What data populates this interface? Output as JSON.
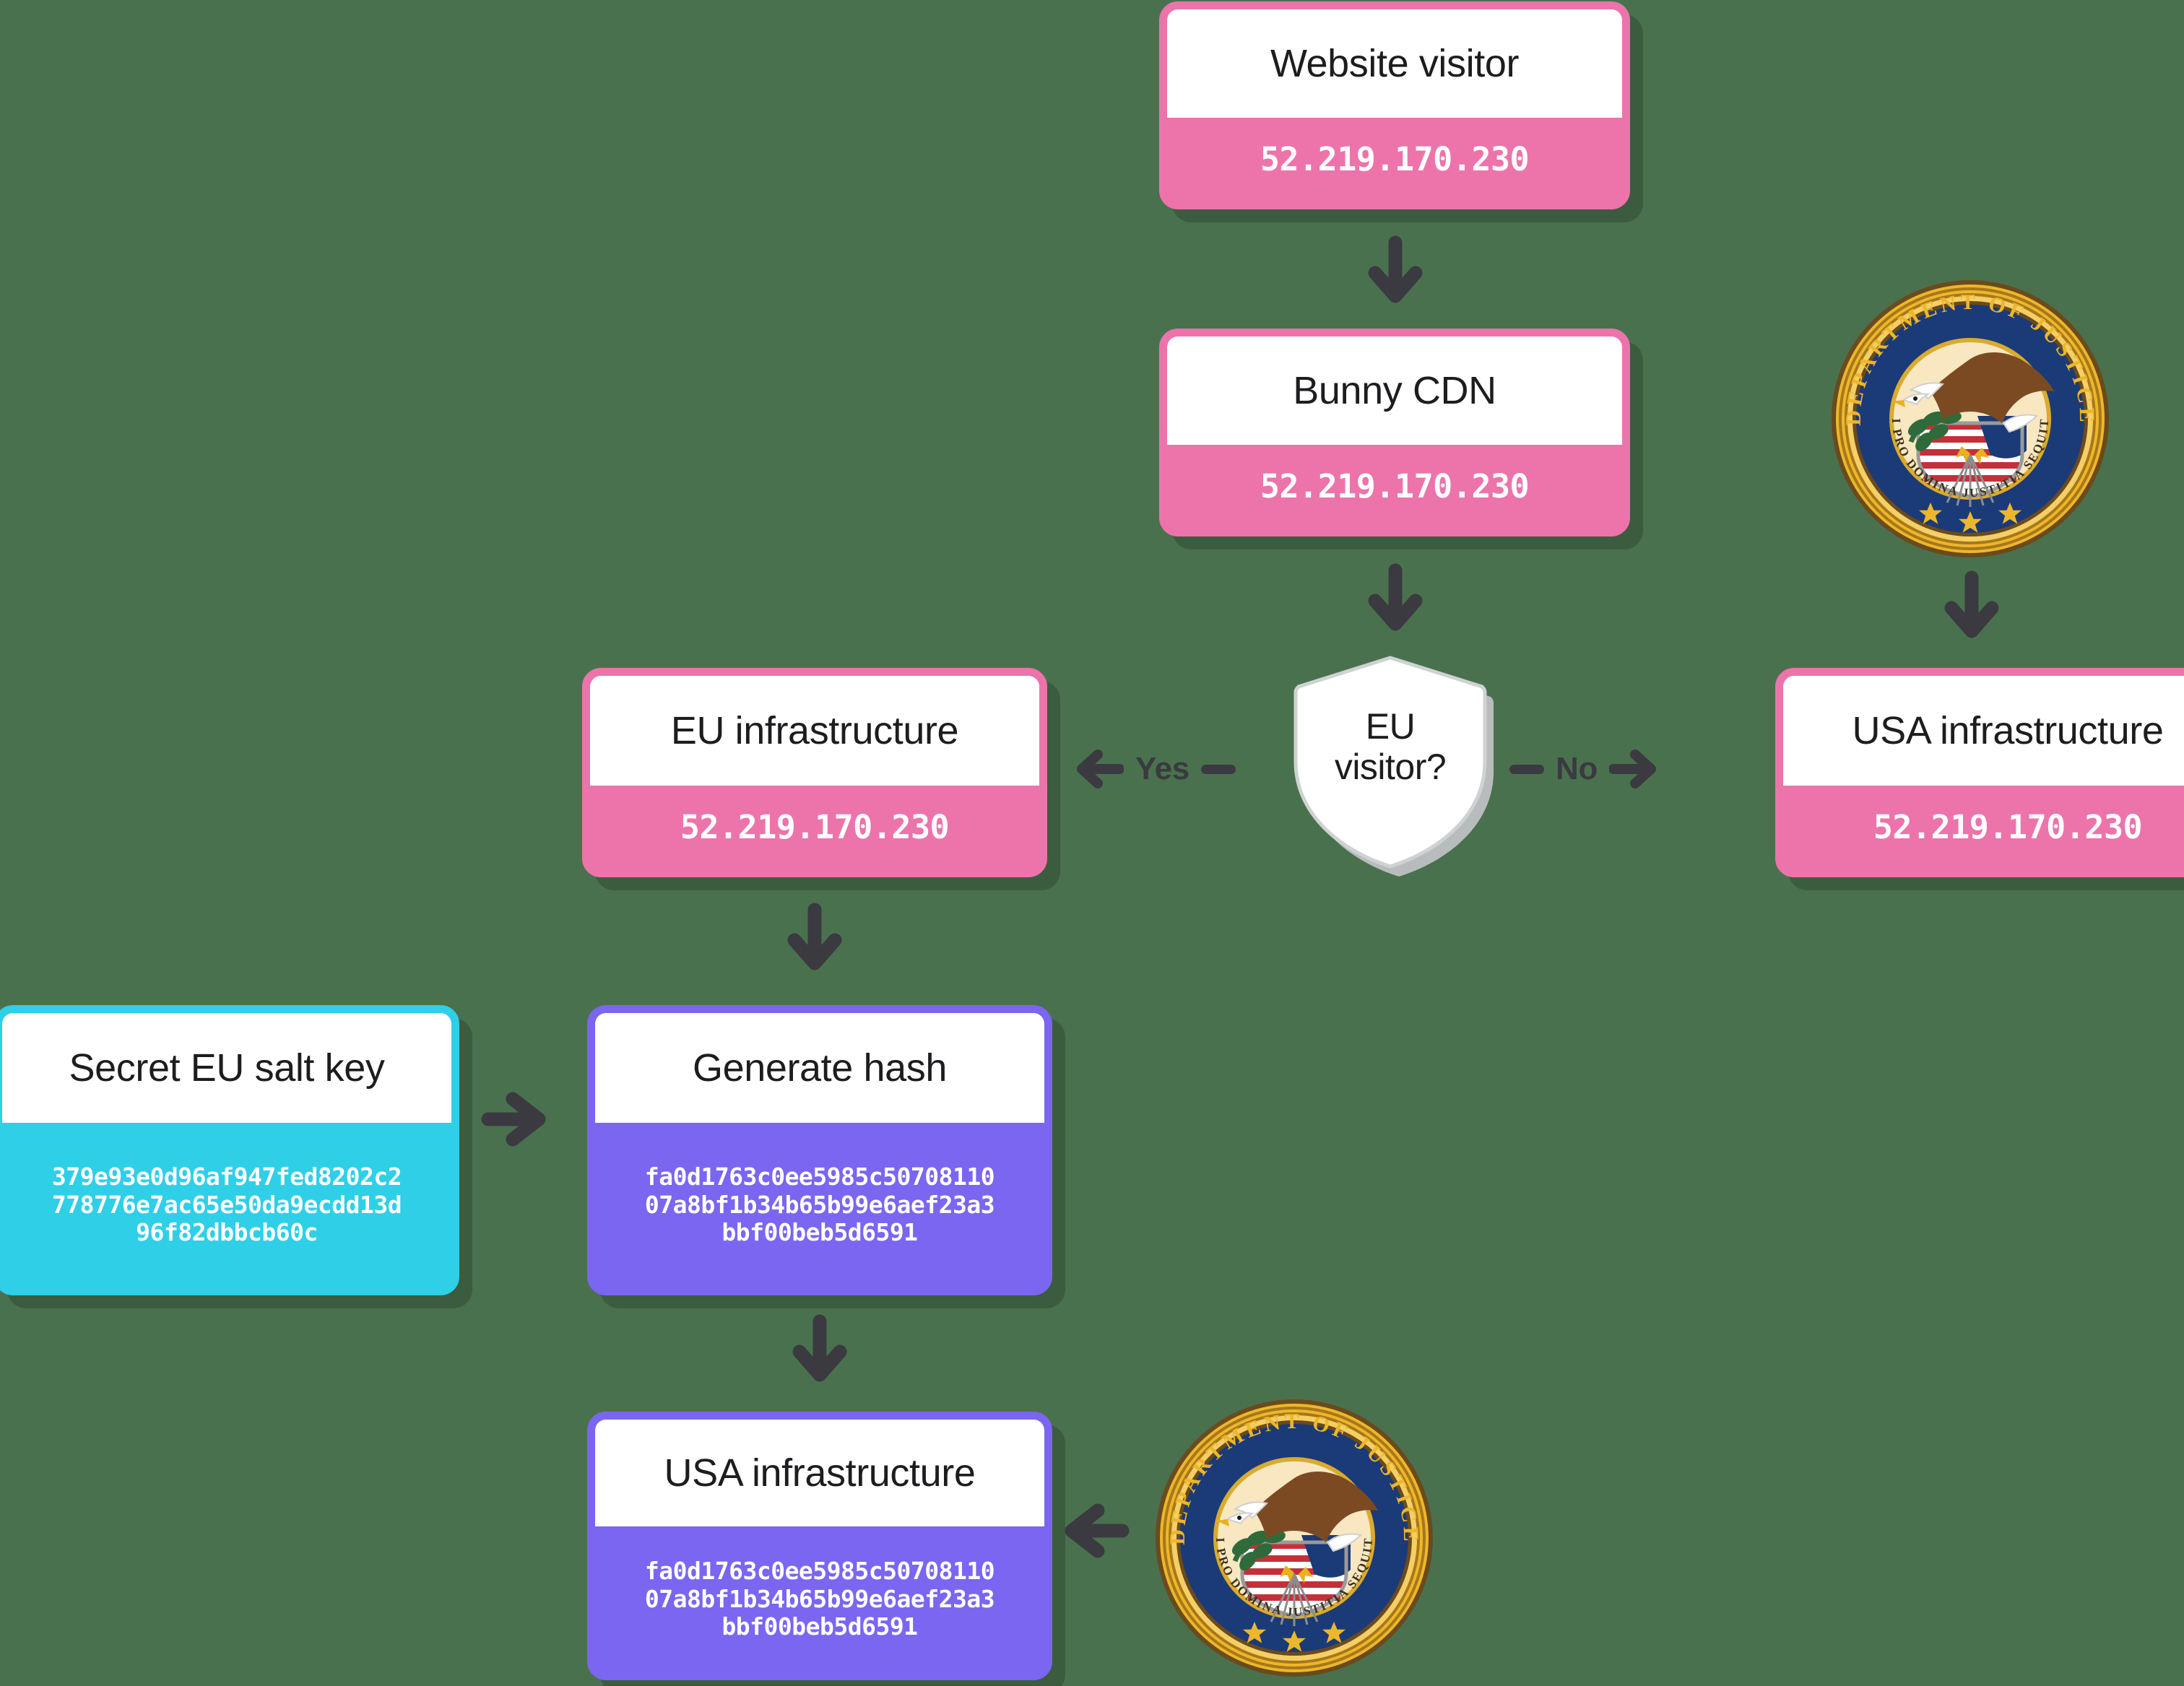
{
  "background_color": "#4a714e",
  "palette": {
    "pink": "#ec74ab",
    "purple": "#7a66f0",
    "cyan": "#2fcfe8",
    "arrow": "#3a3a40",
    "card_title_bg": "#ffffff",
    "shield_fill": "#ffffff",
    "shield_shadow": "#b9bcbd"
  },
  "diagram": {
    "type": "flowchart",
    "nodes": {
      "website_visitor": {
        "title": "Website visitor",
        "value": "52.219.170.230",
        "color": "pink"
      },
      "bunny_cdn": {
        "title": "Bunny CDN",
        "value": "52.219.170.230",
        "color": "pink"
      },
      "decision": {
        "line1": "EU",
        "line2": "visitor?",
        "shape": "shield"
      },
      "eu_infrastructure": {
        "title": "EU infrastructure",
        "value": "52.219.170.230",
        "color": "pink"
      },
      "usa_infrastructure_right": {
        "title": "USA infrastructure",
        "value": "52.219.170.230",
        "color": "pink"
      },
      "secret_eu_salt_key": {
        "title": "Secret EU salt key",
        "value": "379e93e0d96af947fed8202c2\n778776e7ac65e50da9ecdd13d\n96f82dbbcb60c",
        "color": "cyan"
      },
      "generate_hash": {
        "title": "Generate hash",
        "value": "fa0d1763c0ee5985c50708110\n07a8bf1b34b65b99e6aef23a3\nbbf00beb5d6591",
        "color": "purple"
      },
      "usa_infrastructure_bottom": {
        "title": "USA infrastructure",
        "value": "fa0d1763c0ee5985c50708110\n07a8bf1b34b65b99e6aef23a3\nbbf00beb5d6591",
        "color": "purple"
      }
    },
    "edges": [
      {
        "from": "website_visitor",
        "to": "bunny_cdn",
        "direction": "down",
        "label": ""
      },
      {
        "from": "bunny_cdn",
        "to": "decision",
        "direction": "down",
        "label": ""
      },
      {
        "from": "decision",
        "to": "eu_infrastructure",
        "direction": "left",
        "label": "Yes"
      },
      {
        "from": "decision",
        "to": "usa_infrastructure_right",
        "direction": "right",
        "label": "No"
      },
      {
        "from": "doj_seal_top",
        "to": "usa_infrastructure_right",
        "direction": "down",
        "label": ""
      },
      {
        "from": "eu_infrastructure",
        "to": "generate_hash",
        "direction": "down",
        "label": ""
      },
      {
        "from": "secret_eu_salt_key",
        "to": "generate_hash",
        "direction": "right",
        "label": ""
      },
      {
        "from": "generate_hash",
        "to": "usa_infrastructure_bottom",
        "direction": "down",
        "label": ""
      },
      {
        "from": "doj_seal_bottom",
        "to": "usa_infrastructure_bottom",
        "direction": "left",
        "label": ""
      }
    ],
    "labels": {
      "yes": "Yes",
      "no": "No"
    },
    "seal": {
      "ring_text": "DEPARTMENT OF JUSTICE",
      "motto": "QUI PRO DOMINA JUSTITIA SEQUITUR",
      "colors": {
        "rope": "#edb72b",
        "ring": "#1b3a78",
        "field": "#f8e7c0",
        "eagle": "#7b4a23",
        "stripe_red": "#c4303a",
        "star": "#edb72b"
      }
    }
  }
}
